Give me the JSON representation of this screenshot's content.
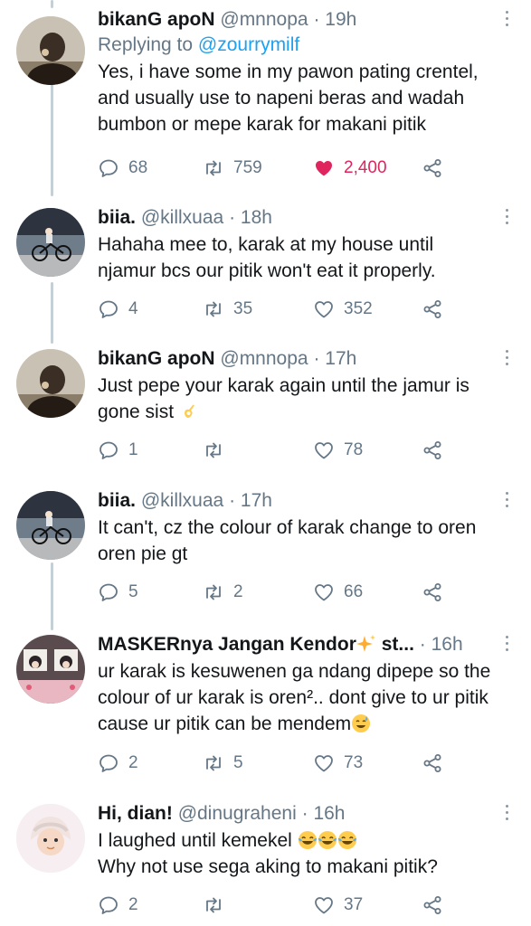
{
  "tweets": [
    {
      "name": "bikanG apoN",
      "handle": "@mnnopa",
      "time": "19h",
      "reply_prefix": "Replying to ",
      "reply_to": "@zourrymilf",
      "text": "Yes, i have some in my pawon pating crentel, and usually use to napeni beras and wadah bumbon or mepe karak for makani pitik",
      "replies": "68",
      "retweets": "759",
      "likes": "2,400",
      "liked": true
    },
    {
      "name": "biia.",
      "handle": "@killxuaa",
      "time": "18h",
      "text": "Hahaha mee to, karak at my house until njamur bcs our pitik won't eat it properly.",
      "replies": "4",
      "retweets": "35",
      "likes": "352",
      "liked": false
    },
    {
      "name": "bikanG apoN",
      "handle": "@mnnopa",
      "time": "17h",
      "text": "Just pepe your karak again until the jamur is gone sist",
      "emoji": "ok-hand-emoji",
      "replies": "1",
      "retweets": "",
      "likes": "78",
      "liked": false
    },
    {
      "name": "biia.",
      "handle": "@killxuaa",
      "time": "17h",
      "text": "It can't, cz the colour of karak change to oren oren pie gt",
      "replies": "5",
      "retweets": "2",
      "likes": "66",
      "liked": false
    },
    {
      "name": "MASKERnya Jangan Kendor",
      "name_suffix": " st...",
      "name_emoji": "sparkles-emoji",
      "handle": "",
      "time": "16h",
      "text": "ur karak is kesuwenen ga ndang dipepe so the colour of ur karak is oren².. dont give to ur pitik cause ur pitik can be mendem",
      "emoji": "sweat-smile-emoji",
      "replies": "2",
      "retweets": "5",
      "likes": "73",
      "liked": false
    },
    {
      "name": "Hi, dian!",
      "handle": "@dinugraheni",
      "time": "16h",
      "text_line1": "I laughed until kemekel",
      "emojis_line1": [
        "joy-emoji",
        "joy-emoji",
        "joy-emoji"
      ],
      "text_line2": "Why not use sega aking to makani pitik?",
      "replies": "2",
      "retweets": "",
      "likes": "37",
      "liked": false
    }
  ],
  "separator": "·",
  "colors": {
    "accent": "#1da1f2",
    "like": "#e0245e",
    "muted": "#657786",
    "thread_line": "#c4cfd6"
  },
  "icons": [
    "reply-icon",
    "retweet-icon",
    "heart-icon",
    "share-icon",
    "more-icon"
  ]
}
